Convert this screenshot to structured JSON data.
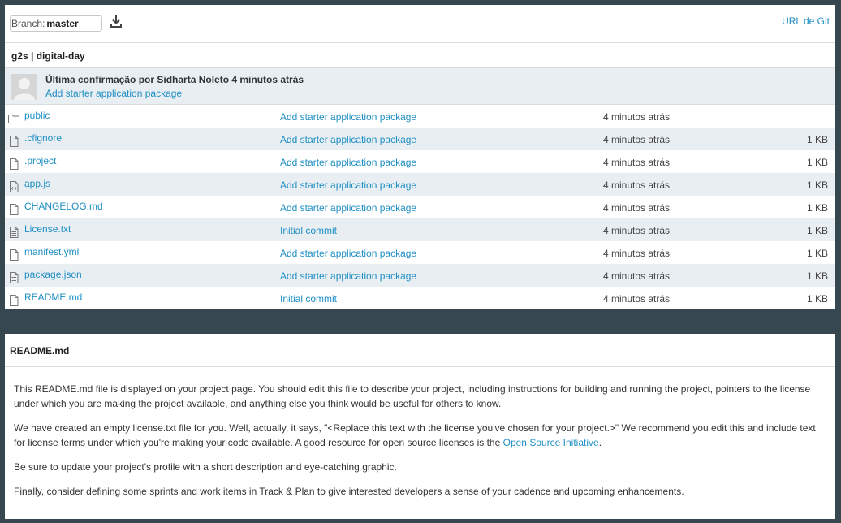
{
  "toolbar": {
    "branch_label": "Branch:",
    "branch_value": "master",
    "git_url_label": "URL de Git"
  },
  "repo": {
    "title": "g2s | digital-day"
  },
  "commit": {
    "title": "Última confirmação por Sidharta Noleto 4 minutos atrás",
    "message": "Add starter application package"
  },
  "files": [
    {
      "name": "public",
      "message": "Add starter application package",
      "time": "4 minutos atrás",
      "size": "",
      "icon": "folder-icon"
    },
    {
      "name": ".cfignore",
      "message": "Add starter application package",
      "time": "4 minutos atrás",
      "size": "1 KB",
      "icon": "file-icon"
    },
    {
      "name": ".project",
      "message": "Add starter application package",
      "time": "4 minutos atrás",
      "size": "1 KB",
      "icon": "file-icon"
    },
    {
      "name": "app.js",
      "message": "Add starter application package",
      "time": "4 minutos atrás",
      "size": "1 KB",
      "icon": "code-file-icon"
    },
    {
      "name": "CHANGELOG.md",
      "message": "Add starter application package",
      "time": "4 minutos atrás",
      "size": "1 KB",
      "icon": "file-icon"
    },
    {
      "name": "License.txt",
      "message": "Initial commit",
      "time": "4 minutos atrás",
      "size": "1 KB",
      "icon": "text-file-icon"
    },
    {
      "name": "manifest.yml",
      "message": "Add starter application package",
      "time": "4 minutos atrás",
      "size": "1 KB",
      "icon": "file-icon"
    },
    {
      "name": "package.json",
      "message": "Add starter application package",
      "time": "4 minutos atrás",
      "size": "1 KB",
      "icon": "text-file-icon"
    },
    {
      "name": "README.md",
      "message": "Initial commit",
      "time": "4 minutos atrás",
      "size": "1 KB",
      "icon": "file-icon"
    }
  ],
  "readme": {
    "title": "README.md",
    "p1": "This README.md file is displayed on your project page. You should edit this file to describe your project, including instructions for building and running the project, pointers to the license under which you are making the project available, and anything else you think would be useful for others to know.",
    "p2_before": "We have created an empty license.txt file for you. Well, actually, it says, \"<Replace this text with the license you've chosen for your project.>\" We recommend you edit this and include text for license terms under which you're making your code available. A good resource for open source licenses is the ",
    "p2_link": "Open Source Initiative",
    "p2_after": ".",
    "p3": "Be sure to update your project's profile with a short description and eye-catching graphic.",
    "p4": "Finally, consider defining some sprints and work items in Track & Plan to give interested developers a sense of your cadence and upcoming enhancements."
  },
  "colors": {
    "background": "#37474f",
    "link": "#1f8fc4",
    "alt_row": "#e8eef2"
  }
}
